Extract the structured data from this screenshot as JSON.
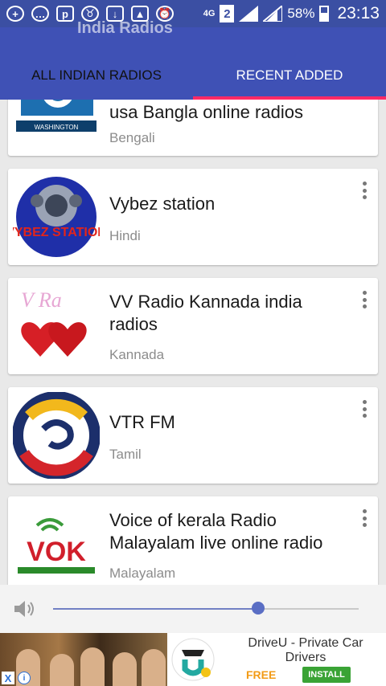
{
  "status_bar": {
    "network": "4G",
    "sim_slot": "2",
    "battery": "58%",
    "time": "23:13"
  },
  "app_bar": {
    "title": "India Radios"
  },
  "tabs": [
    {
      "label": "ALL INDIAN RADIOS",
      "selected": false
    },
    {
      "label": "RECENT ADDED",
      "selected": true
    }
  ],
  "accent_color": "#ff2a66",
  "stations": [
    {
      "title": "usa Bangla online radios",
      "language": "Bengali",
      "logo_text": "WASHINGTON"
    },
    {
      "title": "Vybez station",
      "language": "Hindi",
      "logo_text": "VYBEZ STATION"
    },
    {
      "title": "VV Radio Kannada india radios",
      "language": "Kannada",
      "logo_text": "V Ra"
    },
    {
      "title": "VTR FM",
      "language": "Tamil",
      "logo_text": ""
    },
    {
      "title": "Voice of kerala Radio Malayalam live online radio",
      "language": "Malayalam",
      "logo_text": "VOK"
    }
  ],
  "player": {
    "volume_level": 0.67
  },
  "ad": {
    "title": "DriveU - Private Car Drivers",
    "price": "FREE",
    "install_label": "INSTALL",
    "close_label": "X",
    "info_label": "i"
  }
}
